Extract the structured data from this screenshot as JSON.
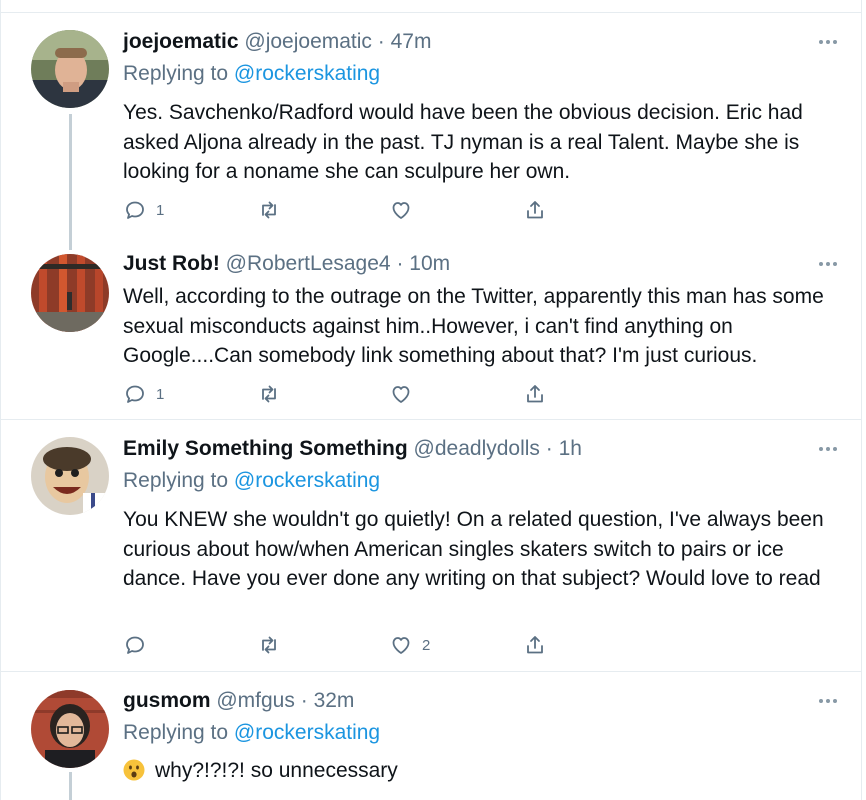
{
  "tweets": [
    {
      "name": "joejoematic",
      "handle": "@joejoematic",
      "time": "47m",
      "replying_label": "Replying to",
      "replying_to": "@rockerskating",
      "text": "Yes. Savchenko/Radford would have been the obvious decision. Eric had asked Aljona already in the past. TJ nyman is a real Talent. Maybe she is looking for a noname she can sculpure her own.",
      "reply_count": "1",
      "retweet_count": "",
      "like_count": ""
    },
    {
      "name": "Just Rob!",
      "handle": "@RobertLesage4",
      "time": "10m",
      "text": "Well, according to the outrage on the Twitter, apparently this man has some sexual misconducts against him..However, i can't find anything on Google....Can somebody link something about that? I'm just curious.",
      "reply_count": "1",
      "retweet_count": "",
      "like_count": ""
    },
    {
      "name": "Emily Something Something",
      "handle": "@deadlydolls",
      "time": "1h",
      "replying_label": "Replying to",
      "replying_to": "@rockerskating",
      "text": "You KNEW she wouldn't go quietly! On a related question, I've always been curious about how/when American singles skaters switch to pairs or ice dance. Have you ever done any writing on that subject? Would love to read",
      "reply_count": "",
      "retweet_count": "",
      "like_count": "2"
    },
    {
      "name": "gusmom",
      "handle": "@mfgus",
      "time": "32m",
      "replying_label": "Replying to",
      "replying_to": "@rockerskating",
      "text": "why?!?!?! so unnecessary",
      "emoji": "astonished-face"
    }
  ],
  "separator": "·",
  "colors": {
    "link": "#1b95e0",
    "muted": "#5b7083",
    "divider": "#e6ecf0",
    "thread": "#c4cfd6"
  }
}
